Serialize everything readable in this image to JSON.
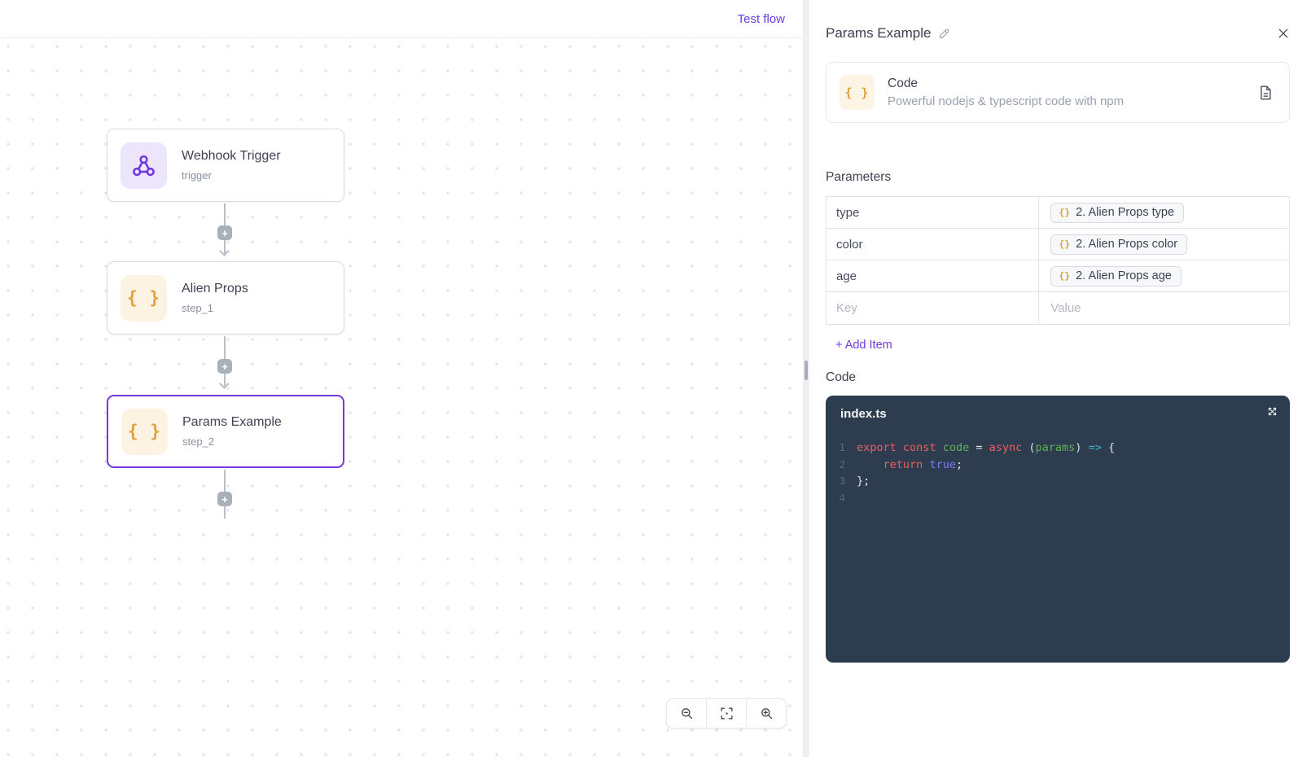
{
  "canvas": {
    "topbar": {
      "test_flow_label": "Test flow"
    },
    "nodes": [
      {
        "title": "Webhook Trigger",
        "subtitle": "trigger",
        "icon": "webhook-icon"
      },
      {
        "title": "Alien Props",
        "subtitle": "step_1",
        "icon": "braces-icon",
        "icon_glyph": "{ }"
      },
      {
        "title": "Params Example",
        "subtitle": "step_2",
        "icon": "braces-icon",
        "icon_glyph": "{ }",
        "selected": true
      }
    ],
    "connector_plus_label": "+",
    "zoom_toolbar": {
      "icons": [
        "zoom-out-icon",
        "fit-view-icon",
        "zoom-in-icon"
      ]
    }
  },
  "panel": {
    "title": "Params Example",
    "step_card": {
      "title": "Code",
      "subtitle": "Powerful nodejs & typescript code with npm",
      "icon_glyph": "{ }"
    },
    "parameters": {
      "heading": "Parameters",
      "chip_glyph": "{}",
      "rows": [
        {
          "key": "type",
          "value": "2. Alien Props type"
        },
        {
          "key": "color",
          "value": "2. Alien Props color"
        },
        {
          "key": "age",
          "value": "2. Alien Props age"
        }
      ],
      "key_placeholder": "Key",
      "value_placeholder": "Value",
      "add_item_label": "+ Add Item"
    },
    "code_section": {
      "heading": "Code",
      "filename": "index.ts",
      "lines": [
        {
          "num": "1",
          "tokens": [
            [
              "kw",
              "export"
            ],
            [
              "pl",
              " "
            ],
            [
              "kw",
              "const"
            ],
            [
              "pl",
              " "
            ],
            [
              "fn",
              "code"
            ],
            [
              "pl",
              " = "
            ],
            [
              "kw",
              "async"
            ],
            [
              "pl",
              " ("
            ],
            [
              "fn",
              "params"
            ],
            [
              "pl",
              ") "
            ],
            [
              "ar",
              "=>"
            ],
            [
              "pl",
              " {"
            ]
          ]
        },
        {
          "num": "2",
          "tokens": [
            [
              "pl",
              "    "
            ],
            [
              "kw",
              "return"
            ],
            [
              "pl",
              " "
            ],
            [
              "bo",
              "true"
            ],
            [
              "pl",
              ";"
            ]
          ]
        },
        {
          "num": "3",
          "tokens": [
            [
              "pl",
              "};"
            ]
          ]
        },
        {
          "num": "4",
          "tokens": []
        }
      ]
    }
  },
  "colors": {
    "accent_purple": "#6d3be4",
    "selected_node_border": "#7438e2",
    "icon_orange": "#dfa23a",
    "node_icon_purple_bg": "#ece5fb",
    "node_icon_cream_bg": "#fcf3e3",
    "editor_background": "#2d3c4e",
    "token_keyword": "#ee5d62",
    "token_identifier": "#5eb54e",
    "token_arrow": "#36b9c3",
    "token_boolean": "#7f7bef"
  }
}
